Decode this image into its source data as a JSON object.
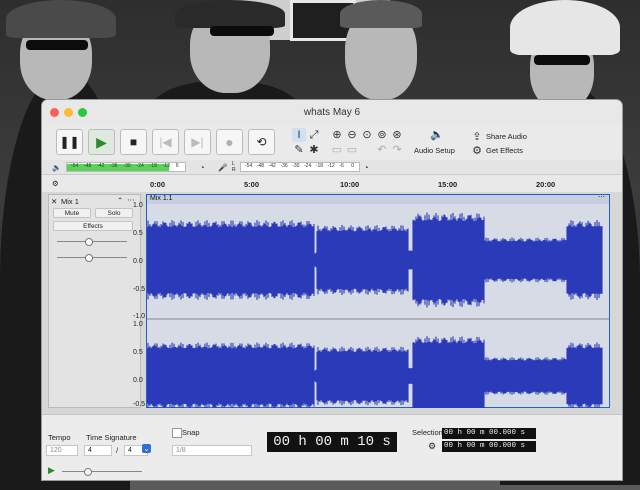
{
  "window": {
    "title": "whats May 6"
  },
  "transport": {
    "pause": "❚❚",
    "play": "▶",
    "stop": "■",
    "skip_start": "|◀",
    "skip_end": "▶|",
    "record": "●",
    "loop": "⟲"
  },
  "toolbar": {
    "audio_setup": "Audio Setup",
    "share_audio": "Share Audio",
    "get_effects": "Get Effects"
  },
  "meters": {
    "playback_ticks": [
      "-54",
      "-48",
      "-42",
      "-36",
      "-30",
      "-24",
      "-18",
      "-12",
      "6"
    ],
    "record_ticks": [
      "-54",
      "-48",
      "-42",
      "-36",
      "-30",
      "-24",
      "-18",
      "-12",
      "-6",
      "0"
    ],
    "l": "L",
    "r": "R"
  },
  "timeline": {
    "ticks": [
      "0:00",
      "5:00",
      "10:00",
      "15:00",
      "20:00"
    ]
  },
  "track": {
    "name": "Mix 1",
    "mute": "Mute",
    "solo": "Solo",
    "effects": "Effects",
    "clip_name": "Mix 1.1",
    "scale": [
      "1.0",
      "0.5",
      "0.0",
      "-0.5",
      "-1.0",
      "1.0",
      "0.5",
      "0.0",
      "-0.5"
    ]
  },
  "bottom": {
    "tempo_label": "Tempo",
    "tempo_value": "120",
    "time_sig_label": "Time Signature",
    "sig_num": "4",
    "sig_slash": "/",
    "sig_den": "4",
    "snap_label": "Snap",
    "snap_value": "1/8",
    "time_display": "00 h 00 m 10 s",
    "selection_label": "Selection",
    "selection_start": "00 h 00 m 00.000 s",
    "selection_end": "00 h 00 m 00.000 s"
  }
}
